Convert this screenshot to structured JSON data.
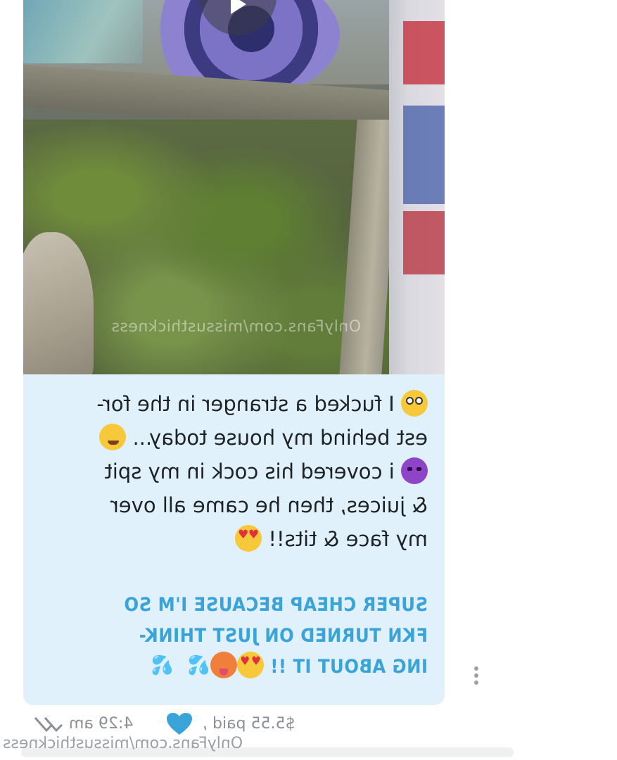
{
  "message": {
    "media": {
      "watermark": "OnlyFans.com/missusthickness"
    },
    "caption_lines": [
      "I fucked a stranger in the for-",
      "est behind my house today...",
      "i covered his cock in my spit",
      "& juices, then he came all over",
      "my face & tits!!"
    ],
    "promo_lines": [
      "SUPER CHEAP BECAUSE I'M SO",
      "FKN TURNED ON JUST THINK-",
      "ING ABOUT IT !!"
    ],
    "emojis": [
      "flushed-face",
      "drooling-face",
      "smiling-devil",
      "heart-eyes",
      "heart-eyes",
      "hot-face",
      "sweat-droplets",
      "sweat-droplets"
    ]
  },
  "meta": {
    "price": "$5.55 paid ,",
    "time": "4:29 am"
  },
  "footer": {
    "watermark": "OnlyFans.com/missusthickness"
  },
  "colors": {
    "bubble": "#e1f1fb",
    "promo_text": "#3aa3d8",
    "heart": "#3aa3d8",
    "meta_text": "#8a9096"
  }
}
